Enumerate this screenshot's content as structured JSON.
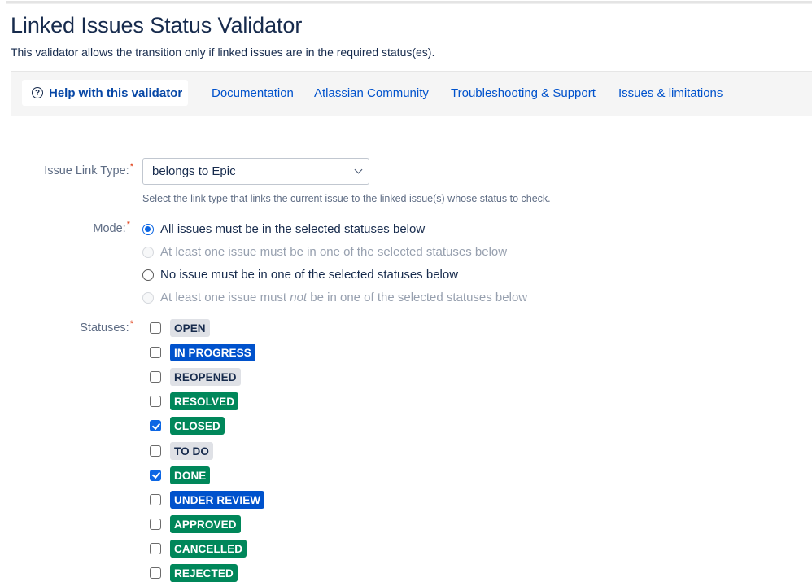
{
  "page": {
    "title": "Linked Issues Status Validator",
    "description": "This validator allows the transition only if linked issues are in the required status(es)."
  },
  "help_bar": {
    "help_tab_label": "Help with this validator",
    "help_icon": "question-circle-icon",
    "links": [
      {
        "label": "Documentation"
      },
      {
        "label": "Atlassian Community"
      },
      {
        "label": "Troubleshooting & Support"
      },
      {
        "label": "Issues & limitations"
      }
    ]
  },
  "form": {
    "required_marker": "*",
    "issue_link_type": {
      "label": "Issue Link Type:",
      "selected_value": "belongs to Epic",
      "help_text": "Select the link type that links the current issue to the linked issue(s) whose status to check."
    },
    "mode": {
      "label": "Mode:",
      "options": [
        {
          "label_pre": "All issues must be in the selected statuses below",
          "label_em": "",
          "label_post": "",
          "checked": true,
          "disabled": false
        },
        {
          "label_pre": "At least one issue must be in one of the selected statuses below",
          "label_em": "",
          "label_post": "",
          "checked": false,
          "disabled": true
        },
        {
          "label_pre": "No issue must be in one of the selected statuses below",
          "label_em": "",
          "label_post": "",
          "checked": false,
          "disabled": false
        },
        {
          "label_pre": "At least one issue must ",
          "label_em": "not",
          "label_post": " be in one of the selected statuses below",
          "checked": false,
          "disabled": true
        }
      ]
    },
    "statuses": {
      "label": "Statuses:",
      "items": [
        {
          "name": "OPEN",
          "category": "grey",
          "checked": false
        },
        {
          "name": "IN PROGRESS",
          "category": "blue",
          "checked": false
        },
        {
          "name": "REOPENED",
          "category": "grey",
          "checked": false
        },
        {
          "name": "RESOLVED",
          "category": "green",
          "checked": false
        },
        {
          "name": "CLOSED",
          "category": "green",
          "checked": true
        },
        {
          "name": "TO DO",
          "category": "grey",
          "checked": false
        },
        {
          "name": "DONE",
          "category": "green",
          "checked": true
        },
        {
          "name": "UNDER REVIEW",
          "category": "blue",
          "checked": false
        },
        {
          "name": "APPROVED",
          "category": "green",
          "checked": false
        },
        {
          "name": "CANCELLED",
          "category": "green",
          "checked": false
        },
        {
          "name": "REJECTED",
          "category": "green",
          "checked": false
        }
      ]
    }
  },
  "colors": {
    "link": "#0052cc",
    "required": "#de350b",
    "status_grey": "#dfe1e6",
    "status_blue": "#0052cc",
    "status_green": "#00875a",
    "checkbox_checked": "#0c66e4"
  }
}
